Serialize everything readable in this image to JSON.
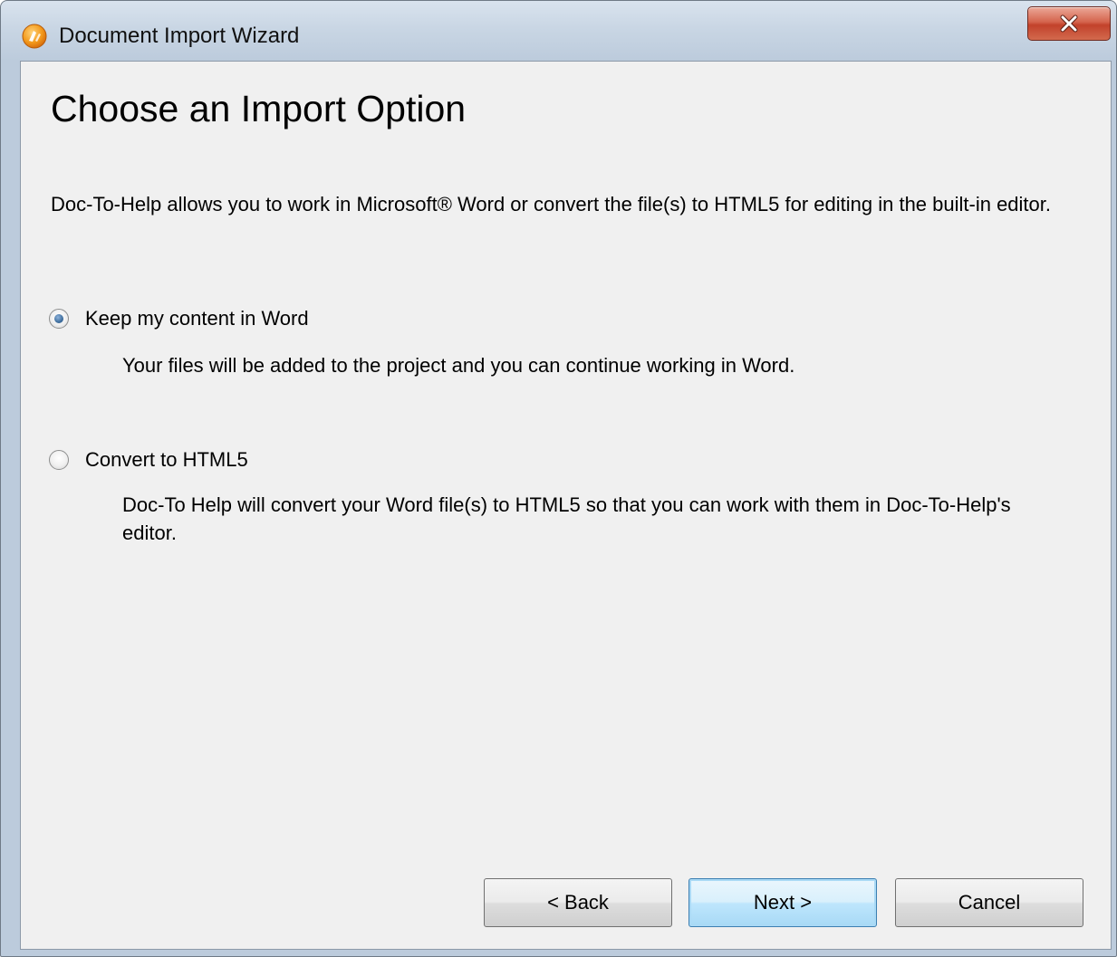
{
  "window": {
    "title": "Document Import Wizard",
    "app_icon": "doc-to-help-logo-icon",
    "close_icon": "close-icon",
    "close_color": "#c7442d"
  },
  "page": {
    "title": "Choose an Import Option",
    "intro": "Doc-To-Help allows you to work in Microsoft® Word or convert the file(s) to HTML5 for editing in the built-in editor."
  },
  "options": [
    {
      "label": "Keep my content in Word",
      "description": "Your files will be added to the project and you can continue working in Word.",
      "selected": true
    },
    {
      "label": "Convert to HTML5",
      "description": "Doc-To Help will convert your Word file(s) to HTML5 so that you can work with them in Doc-To-Help's editor.",
      "selected": false
    }
  ],
  "buttons": {
    "back": "< Back",
    "next": "Next >",
    "cancel": "Cancel",
    "default": "next"
  }
}
